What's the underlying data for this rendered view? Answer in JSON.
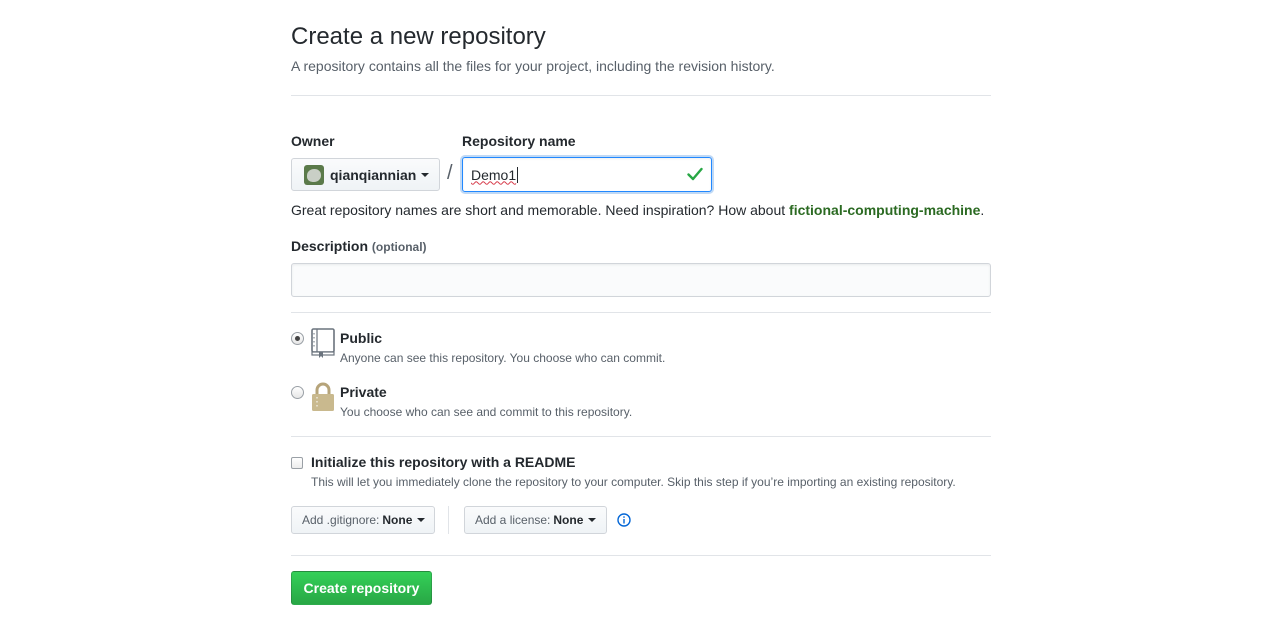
{
  "page": {
    "title": "Create a new repository",
    "subtitle": "A repository contains all the files for your project, including the revision history."
  },
  "owner": {
    "label": "Owner",
    "value": "qianqiannian"
  },
  "repo_name": {
    "label": "Repository name",
    "value": "Demo1",
    "separator": "/"
  },
  "hint": {
    "text": "Great repository names are short and memorable. Need inspiration? How about ",
    "suggestion": "fictional-computing-machine",
    "end": "."
  },
  "description": {
    "label": "Description",
    "optional": "(optional)",
    "value": ""
  },
  "visibility": {
    "selected": "public",
    "public": {
      "title": "Public",
      "desc": "Anyone can see this repository. You choose who can commit."
    },
    "private": {
      "title": "Private",
      "desc": "You choose who can see and commit to this repository."
    }
  },
  "readme": {
    "checked": false,
    "title": "Initialize this repository with a README",
    "desc": "This will let you immediately clone the repository to your computer. Skip this step if you’re importing an existing repository."
  },
  "gitignore": {
    "prefix": "Add .gitignore:",
    "value": "None"
  },
  "license": {
    "prefix": "Add a license:",
    "value": "None"
  },
  "submit": {
    "label": "Create repository"
  },
  "colors": {
    "accent_green": "#28a745",
    "suggestion_green": "#2b6a22",
    "focus_blue": "#2188ff",
    "check_green": "#28a745"
  }
}
